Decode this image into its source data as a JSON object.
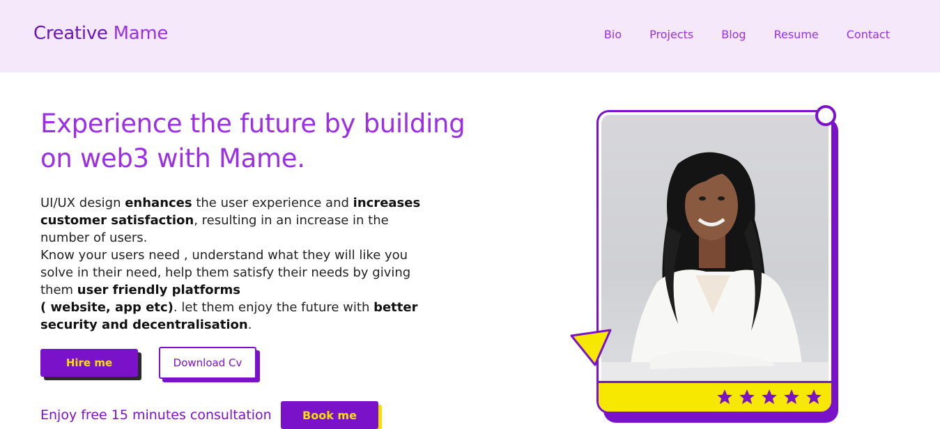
{
  "header": {
    "logo_part1": "Creative",
    "logo_part2": "Mame",
    "nav": [
      "Bio",
      "Projects",
      "Blog",
      "Resume",
      "Contact"
    ]
  },
  "hero": {
    "title": "Experience the future by building on web3 with Mame.",
    "body": {
      "p1_a": "UI/UX design ",
      "p1_b": "enhances",
      "p1_c": " the user experience and ",
      "p1_d": "increases customer satisfaction",
      "p1_e": ", resulting in an increase in the number of users.",
      "p2_a": "Know your users need , understand what they will like you solve in their need, help them satisfy their needs by giving them ",
      "p2_b": "user friendly platforms",
      "p2_c": "( website, app etc)",
      "p2_d": ". let them enjoy the future with ",
      "p2_e": "better security and decentralisation",
      "p2_f": "."
    }
  },
  "buttons": {
    "hire": "Hire me",
    "download_cv": "Download Cv",
    "book": "Book me"
  },
  "consultation_text": "Enjoy free 15 minutes consultation",
  "card": {
    "rating": 5,
    "star_icon": "star-icon"
  },
  "colors": {
    "purple": "#7a12c9",
    "light_purple": "#9b2ee6",
    "yellow": "#f6e000",
    "header_bg": "#f4e8fa"
  }
}
